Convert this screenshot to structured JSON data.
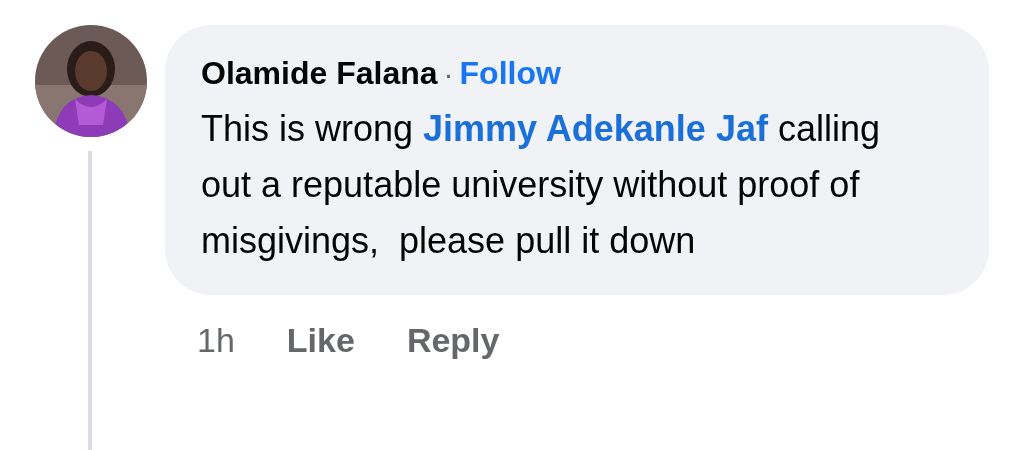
{
  "comment": {
    "author": "Olamide Falana",
    "separator": "·",
    "follow": "Follow",
    "text_before": "This is wrong ",
    "mention": "Jimmy Adekanle Jaf",
    "text_after": " calling out a reputable university without proof of misgivings,  please pull it down"
  },
  "actions": {
    "time": "1h",
    "like": "Like",
    "reply": "Reply"
  }
}
